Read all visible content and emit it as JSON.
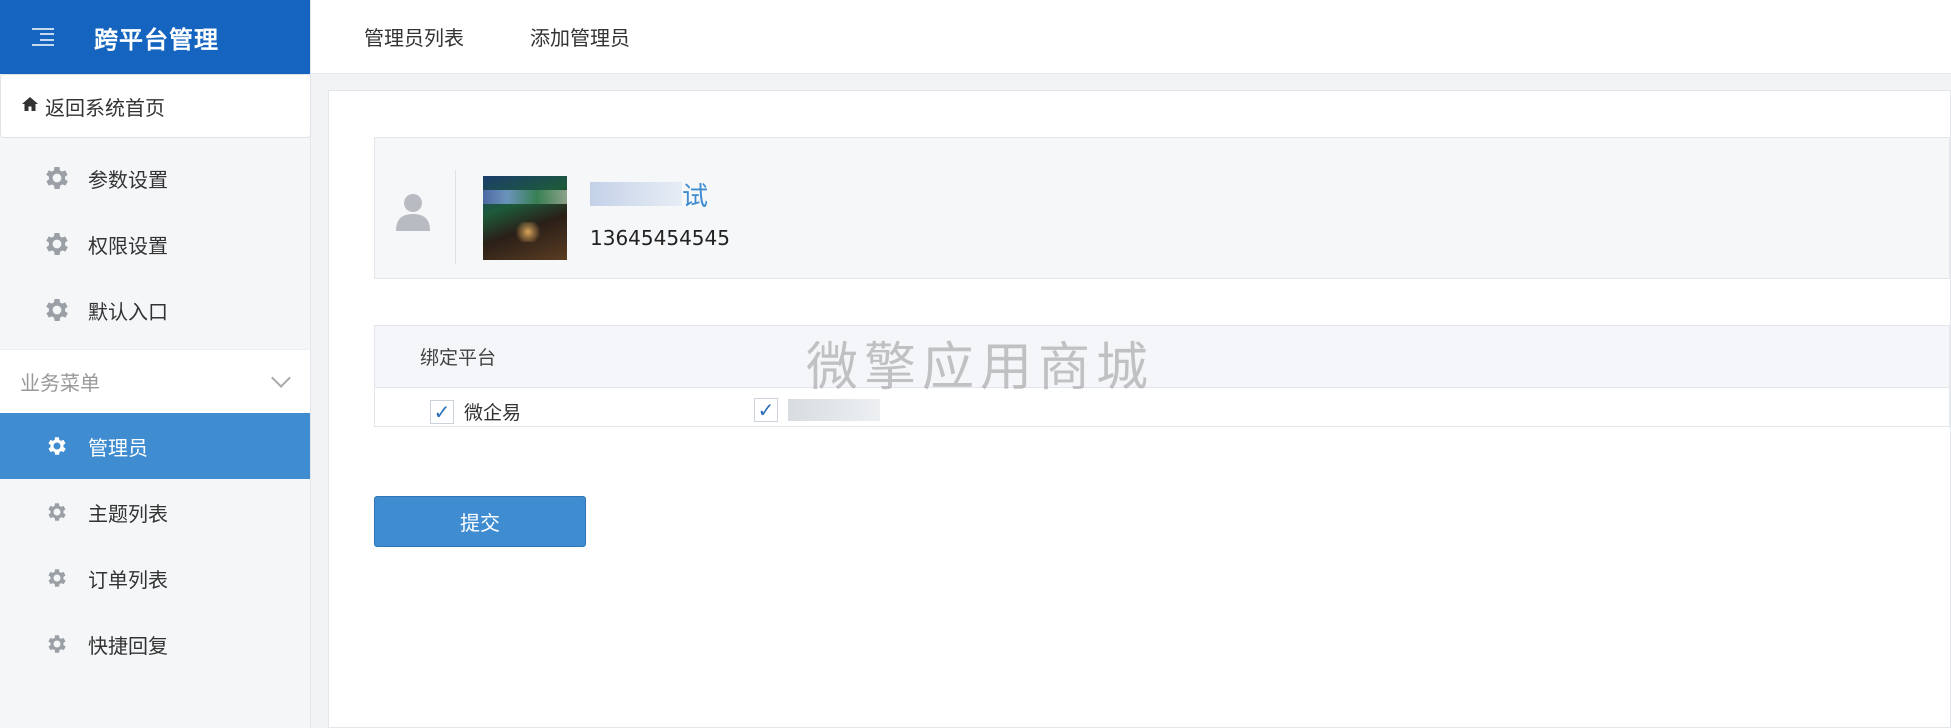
{
  "brand": {
    "title": "跨平台管理",
    "menu_icon": "menu-indent-icon"
  },
  "topnav": {
    "tabs": [
      {
        "label": "管理员列表"
      },
      {
        "label": "添加管理员"
      }
    ]
  },
  "sidebar": {
    "home_link": {
      "label": "返回系统首页",
      "icon": "home-icon"
    },
    "settings": [
      {
        "label": "参数设置",
        "icon": "gear-icon"
      },
      {
        "label": "权限设置",
        "icon": "gear-icon"
      },
      {
        "label": "默认入口",
        "icon": "gear-icon"
      }
    ],
    "section": {
      "label": "业务菜单",
      "icon": "chevron-down-icon"
    },
    "business": [
      {
        "label": "管理员",
        "icon": "gear-icon",
        "active": true
      },
      {
        "label": "主题列表",
        "icon": "gear-icon"
      },
      {
        "label": "订单列表",
        "icon": "gear-icon"
      },
      {
        "label": "快捷回复",
        "icon": "gear-icon"
      }
    ]
  },
  "user": {
    "name_visible": "试",
    "phone": "13645454545",
    "placeholder_icon": "user-icon"
  },
  "bind": {
    "header": "绑定平台",
    "platforms": [
      {
        "label": "微企易",
        "checked": true,
        "check_mark": "✓"
      },
      {
        "label": "",
        "checked": true,
        "check_mark": "✓"
      }
    ]
  },
  "watermark": "微擎应用商城",
  "submit_label": "提交",
  "colors": {
    "brand": "#1565c0",
    "active": "#3f8cd0",
    "link": "#3f8cd0"
  }
}
